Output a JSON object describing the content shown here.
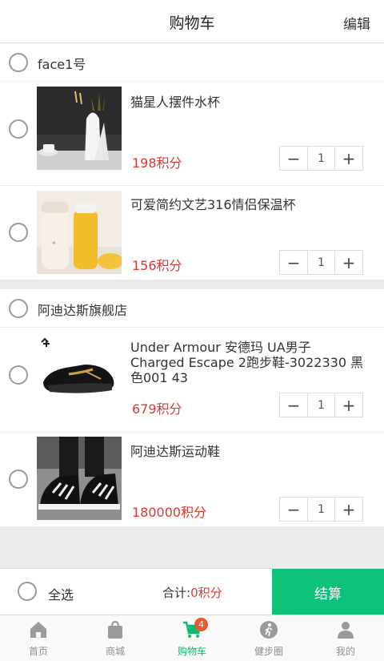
{
  "header": {
    "title": "购物车",
    "edit_label": "编辑"
  },
  "shops": [
    {
      "name": "face1号",
      "items": [
        {
          "name": "猫星人摆件水杯",
          "price": "198积分",
          "quantity": "1"
        },
        {
          "name": "可爱简约文艺316情侣保温杯",
          "price": "156积分",
          "quantity": "1"
        }
      ]
    },
    {
      "name": "阿迪达斯旗舰店",
      "items": [
        {
          "name": "Under Armour 安德玛 UA男子 Charged Escape 2跑步鞋-3022330 黑色001 43",
          "price": "679积分",
          "quantity": "1"
        },
        {
          "name": "阿迪达斯运动鞋",
          "price": "180000积分",
          "quantity": "1"
        }
      ]
    }
  ],
  "stepper": {
    "minus": "−",
    "plus": "+"
  },
  "footer": {
    "select_all": "全选",
    "total_label": "合计:",
    "total_value": "0积分",
    "checkout": "结算"
  },
  "tabbar": {
    "items": [
      {
        "label": "首页",
        "icon": "home-icon"
      },
      {
        "label": "商城",
        "icon": "shopping-bag-icon"
      },
      {
        "label": "购物车",
        "icon": "cart-icon",
        "badge": "4",
        "active": true
      },
      {
        "label": "健步圈",
        "icon": "walking-icon"
      },
      {
        "label": "我的",
        "icon": "user-icon"
      }
    ],
    "active_color": "#0fb96f",
    "inactive_color": "#8f8f8f"
  },
  "colors": {
    "accent": "#0fc27c",
    "price": "#e0362f",
    "badge": "#e85a2e"
  }
}
